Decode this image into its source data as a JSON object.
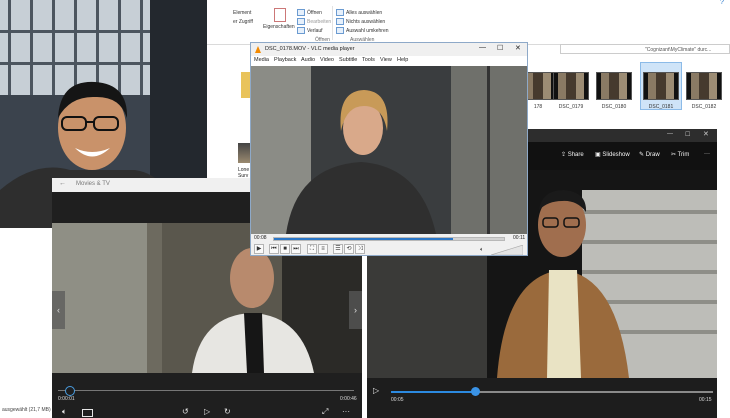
{
  "explorer": {
    "ribbon": {
      "left_items": [
        "Element",
        "er Zugriff"
      ],
      "properties_label": "Eigenschaften",
      "open_items": [
        "Öffnen",
        "Bearbeiten",
        "Verlauf"
      ],
      "open_group": "Öffnen",
      "select_items": [
        "Alles auswählen",
        "Nichts auswählen",
        "Auswahl umkehren"
      ],
      "select_group": "Auswählen"
    },
    "address_hint": "\"Cognizant\\MyClimate\" durc...",
    "partial_file": "Lone",
    "partial_file2": "Surv",
    "thumbnails": [
      {
        "label": "178"
      },
      {
        "label": "DSC_0179"
      },
      {
        "label": "DSC_0180"
      },
      {
        "label": "DSC_0181"
      },
      {
        "label": "DSC_0182"
      }
    ],
    "status": "ausgewählt (21,7 MB)"
  },
  "movies": {
    "title": "Movies & TV",
    "time_current": "0:00:01",
    "time_total": "0:00:46",
    "progress": 0.02
  },
  "vlc": {
    "title": "DSC_0178.MOV - VLC media player",
    "menu": [
      "Media",
      "Playback",
      "Audio",
      "Video",
      "Subtitle",
      "Tools",
      "View",
      "Help"
    ],
    "time_current": "00:08",
    "time_total": "00:11",
    "progress": 0.78
  },
  "photos": {
    "toolbar": {
      "share": "Share",
      "slideshow": "Slideshow",
      "draw": "Draw",
      "trim": "Trim",
      "more": "···"
    },
    "time_current": "00:05",
    "time_total": "00:15",
    "progress": 0.26
  },
  "colors": {
    "vlc_progress": "#2a76c6",
    "photos_accent": "#2c8ae0",
    "selection": "#cfe4f8"
  }
}
